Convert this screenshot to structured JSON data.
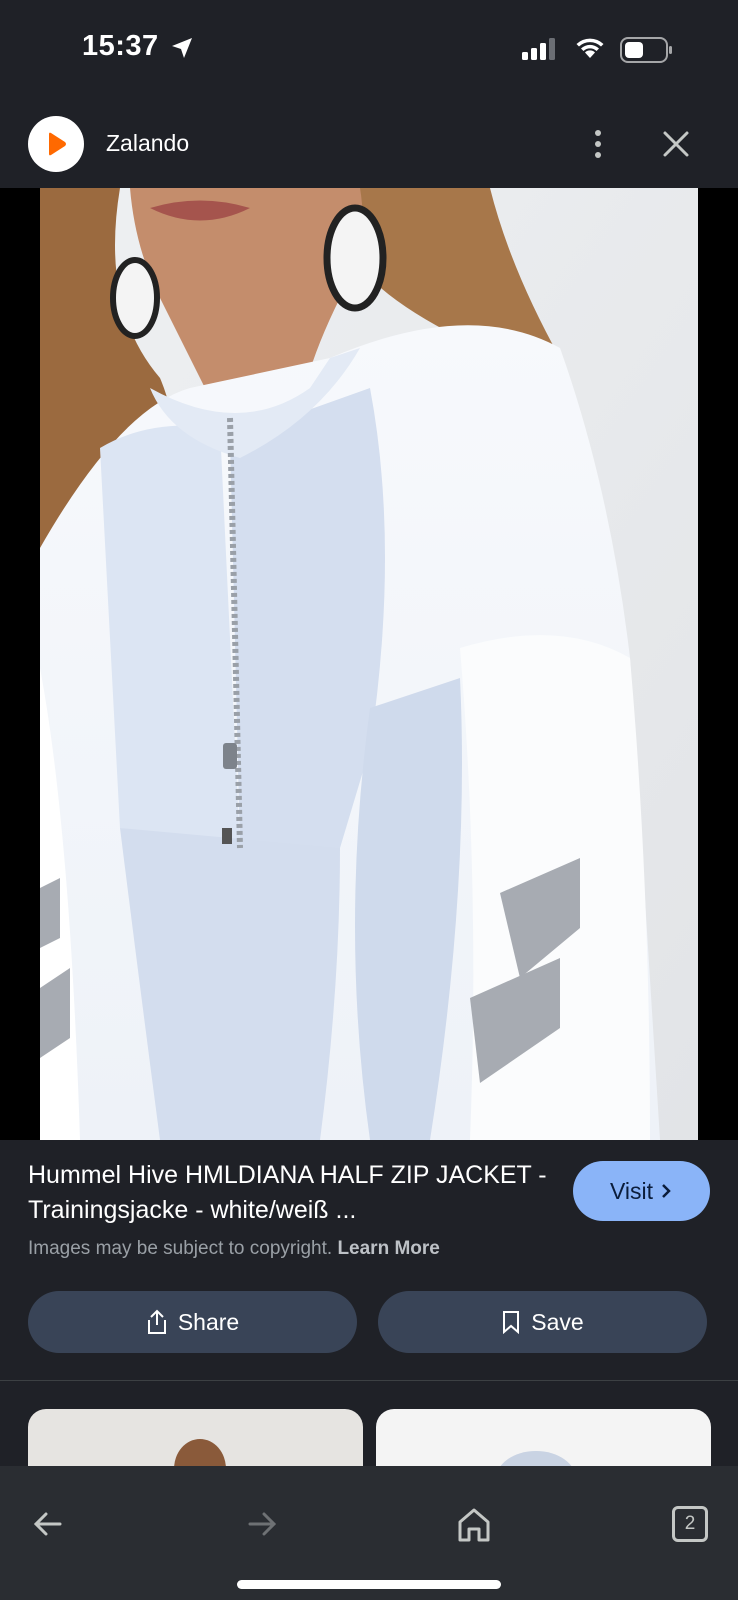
{
  "status_bar": {
    "time": "15:37",
    "icons": [
      "location-arrow-icon",
      "cellular-signal-icon",
      "wifi-icon",
      "battery-icon"
    ]
  },
  "header": {
    "site_name": "Zalando",
    "logo_icon": "zalando-logo-icon",
    "accent_color": "#ff6900",
    "more_icon": "more-vertical-icon",
    "close_icon": "close-icon"
  },
  "product": {
    "title": "Hummel Hive HMLDIANA HALF ZIP JACKET - Trainingsjacke - white/weiß ...",
    "image_alt": "Model wearing light blue and white half zip training jacket"
  },
  "actions": {
    "visit_label": "Visit",
    "visit_color": "#8ab4f8",
    "copyright_text": "Images may be subject to copyright.",
    "learn_more": "Learn More",
    "share_label": "Share",
    "save_label": "Save"
  },
  "bottom_nav": {
    "back_icon": "back-arrow-icon",
    "forward_icon": "forward-arrow-icon",
    "home_icon": "home-icon",
    "tabs_count": "2"
  }
}
